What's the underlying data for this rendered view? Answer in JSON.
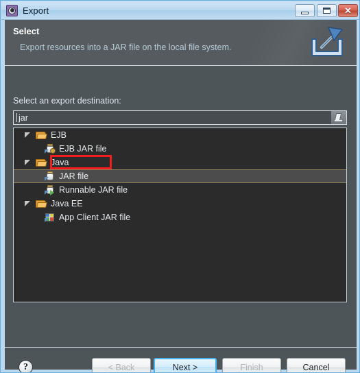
{
  "window": {
    "title": "Export",
    "icon": "export-wizard-gear-icon",
    "controls": {
      "minimize": "minimize-icon",
      "maximize": "maximize-icon",
      "close": "✕"
    }
  },
  "header": {
    "title": "Select",
    "description": "Export resources into a JAR file on the local file system.",
    "icon": "export-arrow-icon"
  },
  "content": {
    "destination_label": "Select an export destination:",
    "filter": {
      "value": "jar",
      "placeholder": "",
      "clear_icon": "eraser-icon"
    },
    "tree": [
      {
        "label": "EJB",
        "type": "folder",
        "expanded": true,
        "level": 0,
        "icon": "open-folder-icon",
        "selected": false
      },
      {
        "label": "EJB JAR file",
        "type": "leaf",
        "expanded": false,
        "level": 1,
        "icon": "ejb-jar-file-icon",
        "selected": false
      },
      {
        "label": "Java",
        "type": "folder",
        "expanded": true,
        "level": 0,
        "icon": "open-folder-icon",
        "selected": false
      },
      {
        "label": "JAR file",
        "type": "leaf",
        "expanded": false,
        "level": 1,
        "icon": "jar-file-icon",
        "selected": true
      },
      {
        "label": "Runnable JAR file",
        "type": "leaf",
        "expanded": false,
        "level": 1,
        "icon": "runnable-jar-icon",
        "selected": false
      },
      {
        "label": "Java EE",
        "type": "folder",
        "expanded": true,
        "level": 0,
        "icon": "open-folder-icon",
        "selected": false
      },
      {
        "label": "App Client JAR file",
        "type": "leaf",
        "expanded": false,
        "level": 1,
        "icon": "app-client-jar-icon",
        "selected": false
      }
    ],
    "highlight": {
      "target": "JAR file",
      "color": "#f41d1d"
    }
  },
  "footer": {
    "help": "?",
    "buttons": [
      {
        "label": "< Back",
        "enabled": false,
        "default": false
      },
      {
        "label": "Next >",
        "enabled": true,
        "default": true
      },
      {
        "label": "Finish",
        "enabled": false,
        "default": false
      },
      {
        "label": "Cancel",
        "enabled": true,
        "default": false
      }
    ]
  },
  "colors": {
    "dialog_bg": "#4e5559",
    "tree_bg": "#2b2b2b",
    "accent": "#4ab4ef",
    "title_bar": "#bcd9f0"
  }
}
